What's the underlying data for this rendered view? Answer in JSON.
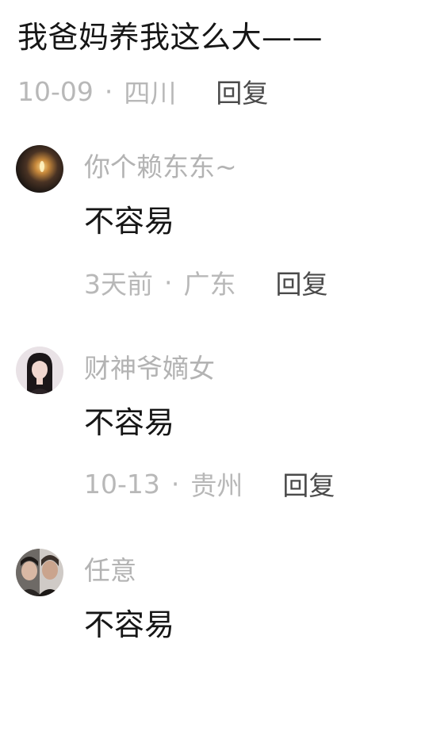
{
  "top_comment": {
    "text": "我爸妈养我这么大——",
    "date": "10-09",
    "separator": "·",
    "location": "四川",
    "reply_label": "回复"
  },
  "replies": [
    {
      "username": "你个赖东东~",
      "text": "不容易",
      "date": "3天前",
      "separator": "·",
      "location": "广东",
      "reply_label": "回复",
      "avatar_icon": "candle-avatar-icon"
    },
    {
      "username": "财神爷嫡女",
      "text": "不容易",
      "date": "10-13",
      "separator": "·",
      "location": "贵州",
      "reply_label": "回复",
      "avatar_icon": "girl-portrait-avatar-icon"
    },
    {
      "username": "任意",
      "text": "不容易",
      "avatar_icon": "two-person-avatar-icon"
    }
  ],
  "colors": {
    "primary_text": "#161616",
    "secondary_text": "#b8b8b8",
    "reply_button": "#4a4a4a"
  }
}
